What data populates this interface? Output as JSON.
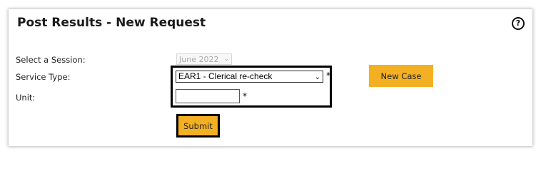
{
  "panel": {
    "title": "Post Results - New Request",
    "help_glyph": "?",
    "help_icon": "question-circle-icon"
  },
  "form": {
    "session_label": "Select a Session:",
    "session_value": "June 2022",
    "session_disabled": true,
    "service_label": "Service Type:",
    "service_value": "EAR1 - Clerical re-check",
    "unit_label": "Unit:",
    "unit_value": "",
    "required_marker": "*"
  },
  "buttons": {
    "new_case_label": "New Case",
    "submit_label": "Submit"
  },
  "colors": {
    "button_accent": "#f4b023",
    "focus_outline": "#000000"
  }
}
